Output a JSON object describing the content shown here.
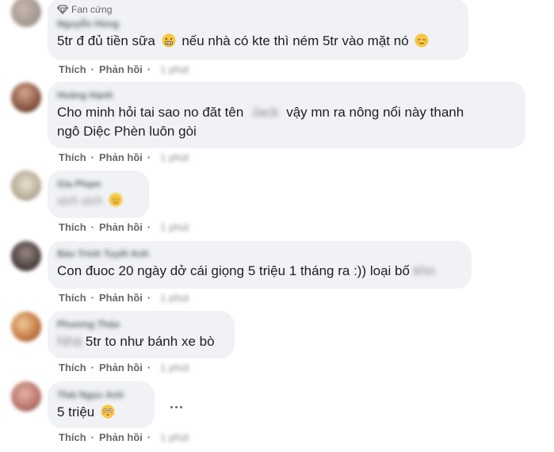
{
  "comments": [
    {
      "author": "Nguyễn Hùng",
      "badge": "Fan cứng",
      "segments": [
        "5tr đ đủ tiền sữa",
        "nếu nhà có kte thì ném 5tr vào mặt nó"
      ],
      "like": "Thích",
      "reply": "Phản hồi",
      "time": "1 phút"
    },
    {
      "author": "Hoàng Hạnh",
      "segments": [
        "Cho minh hỏi tai sao no đăt tên",
        "",
        "vậy mn ra nông nổi này thanh",
        "ngô Diệc Phèn luôn gòi"
      ],
      "like": "Thích",
      "reply": "Phản hồi",
      "time": "1 phút"
    },
    {
      "author": "Gia Phạm",
      "segments": [
        "",
        "xịch xịch"
      ],
      "like": "Thích",
      "reply": "Phản hồi",
      "time": "1 phút"
    },
    {
      "author": "Bảo Trinh Tuyết Anh",
      "segments": [
        "Con đuoc 20 ngày dở cái giọng 5 triệu 1 tháng ra :)) loại bố",
        "khn"
      ],
      "like": "Thích",
      "reply": "Phản hồi",
      "time": "1 phút"
    },
    {
      "author": "Phương Thảo",
      "segments": [
        "Nhà",
        "5tr to như bánh xe bò"
      ],
      "like": "Thích",
      "reply": "Phản hồi",
      "time": "1 phút"
    },
    {
      "author": "Thái Ngọc Anh",
      "segments": [
        "5 triệu"
      ],
      "like": "Thích",
      "reply": "Phản hồi",
      "time": "1 phút"
    }
  ],
  "colors": {
    "bubble": "#f0f2f5",
    "meta": "#65676b",
    "text": "#1c1e21"
  },
  "icons": {
    "badge": "diamond-icon",
    "emoji_grimace": "grimacing-emoji",
    "emoji_relieved": "relieved-emoji",
    "emoji_flushed": "flushed-emoji",
    "more": "more-dots-icon"
  }
}
